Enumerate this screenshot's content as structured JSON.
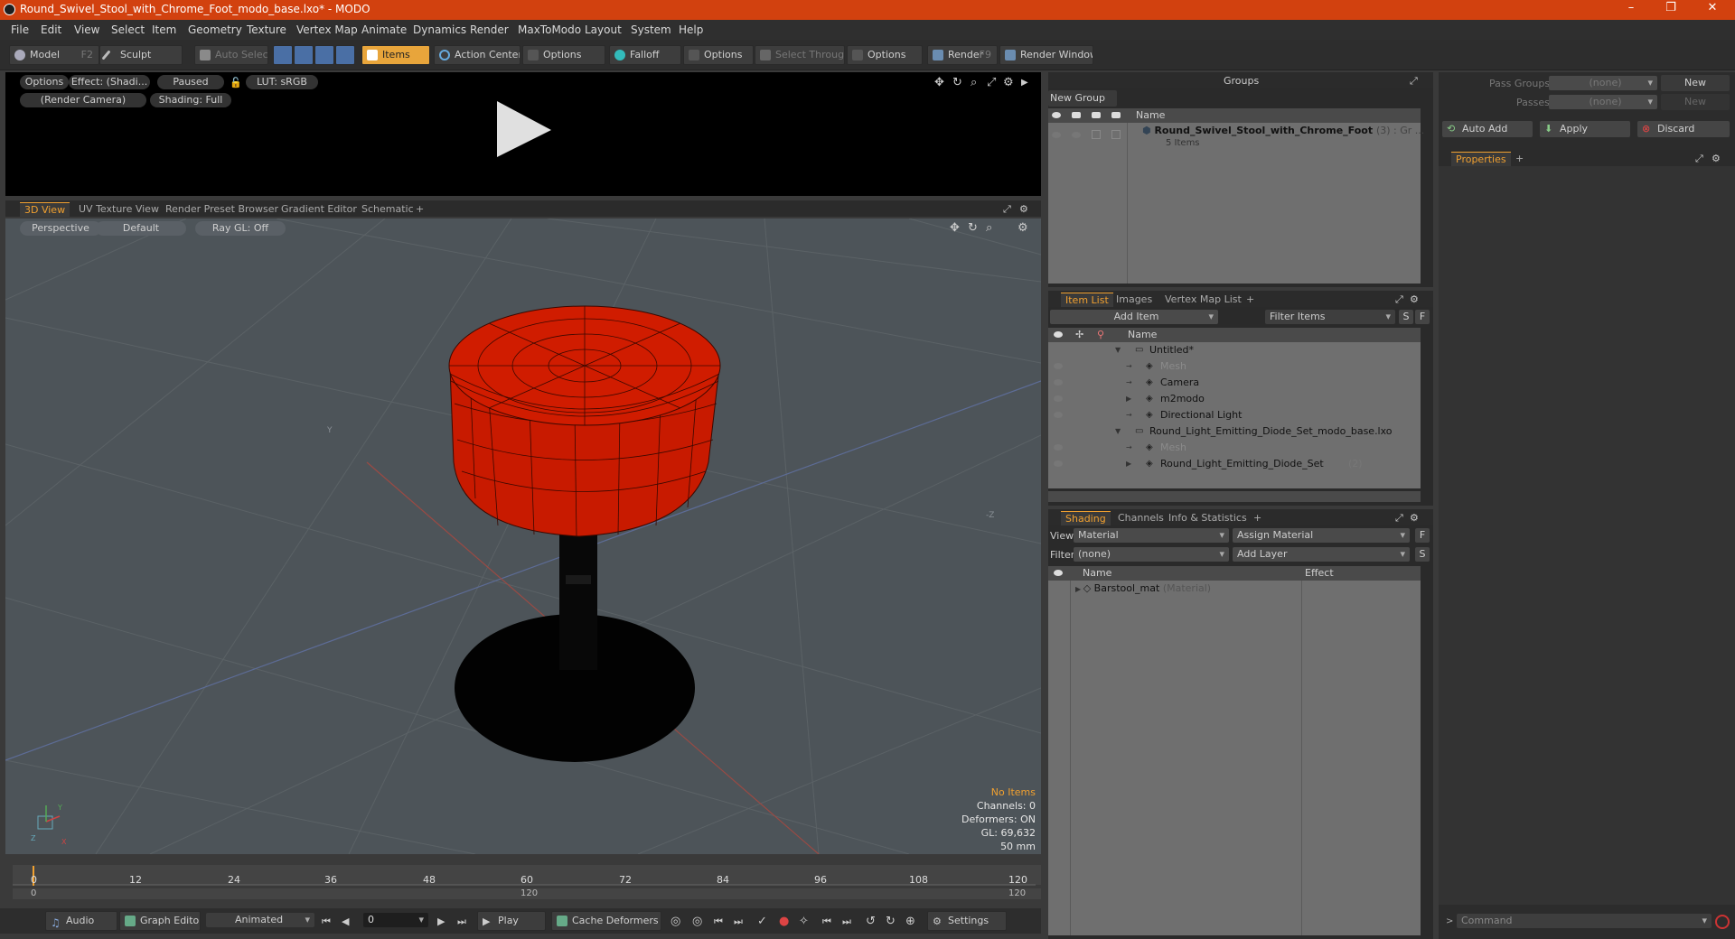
{
  "window": {
    "title": "Round_Swivel_Stool_with_Chrome_Foot_modo_base.lxo* - MODO",
    "minimize": "–",
    "maximize": "❐",
    "close": "✕"
  },
  "menu": [
    "File",
    "Edit",
    "View",
    "Select",
    "Item",
    "Geometry",
    "Texture",
    "Vertex Map",
    "Animate",
    "Dynamics",
    "Render",
    "MaxToModo",
    "Layout",
    "System",
    "Help"
  ],
  "toolbar": {
    "model": "Model",
    "model_key": "F2",
    "sculpt": "Sculpt",
    "auto_select": "Auto Select",
    "items": "Items",
    "action_center": "Action Center",
    "options1": "Options",
    "falloff": "Falloff",
    "options2": "Options",
    "select_through": "Select Through",
    "options3": "Options",
    "render": "Render",
    "render_key": "F9",
    "render_window": "Render Window"
  },
  "preview": {
    "options": "Options",
    "effect": "Effect: (Shadi...",
    "paused": "Paused",
    "lut": "LUT: sRGB",
    "camera": "(Render Camera)",
    "shading": "Shading: Full"
  },
  "view_tabs": [
    "3D View",
    "UV Texture View",
    "Render Preset Browser",
    "Gradient Editor",
    "Schematic",
    "+"
  ],
  "viewport": {
    "perspective": "Perspective",
    "default": "Default",
    "raygl": "Ray GL: Off",
    "no_items": "No Items",
    "channels": "Channels: 0",
    "deformers": "Deformers: ON",
    "gl": "GL: 69,632",
    "lens": "50 mm",
    "axis_y": "Y",
    "axis_z": "-Z",
    "axis_small_x": "X",
    "axis_small_y": "Y",
    "axis_small_z": "Z"
  },
  "timeline": {
    "ticks": [
      "0",
      "12",
      "24",
      "36",
      "48",
      "60",
      "72",
      "84",
      "96",
      "108",
      "120"
    ],
    "sub": [
      "0",
      "120",
      "120"
    ]
  },
  "bottom": {
    "audio": "Audio",
    "graph": "Graph Editor",
    "animated": "Animated",
    "frame": "0",
    "play": "Play",
    "cache": "Cache Deformers",
    "settings": "Settings"
  },
  "groups": {
    "title": "Groups",
    "new_group": "New Group",
    "col_name": "Name",
    "item_name": "Round_Swivel_Stool_with_Chrome_Foot",
    "item_suffix": "(3) : Gr ...",
    "item_count": "5 Items"
  },
  "item_tabs": [
    "Item List",
    "Images",
    "Vertex Map List",
    "+"
  ],
  "item_list": {
    "add_item": "Add Item",
    "filter": "Filter Items",
    "s": "S",
    "f": "F",
    "col_name": "Name",
    "rows": [
      {
        "label": "Untitled*",
        "dim": false,
        "indent": 0,
        "arrow": "▼"
      },
      {
        "label": "Mesh",
        "dim": true,
        "indent": 1,
        "arrow": ""
      },
      {
        "label": "Camera",
        "dim": false,
        "indent": 1,
        "arrow": ""
      },
      {
        "label": "m2modo",
        "dim": false,
        "indent": 1,
        "arrow": "▶"
      },
      {
        "label": "Directional Light",
        "dim": false,
        "indent": 1,
        "arrow": ""
      },
      {
        "label": "Round_Light_Emitting_Diode_Set_modo_base.lxo",
        "dim": false,
        "indent": 0,
        "arrow": "▼"
      },
      {
        "label": "Mesh",
        "dim": true,
        "indent": 1,
        "arrow": ""
      },
      {
        "label": "Round_Light_Emitting_Diode_Set",
        "dim": false,
        "indent": 1,
        "arrow": "▶",
        "suffix": "(2)"
      }
    ]
  },
  "shading_tabs": [
    "Shading",
    "Channels",
    "Info & Statistics",
    "+"
  ],
  "shading": {
    "view_label": "View",
    "view_value": "Material",
    "assign": "Assign Material",
    "f": "F",
    "filter_label": "Filter",
    "filter_value": "(none)",
    "add_layer": "Add Layer",
    "s": "S",
    "col_name": "Name",
    "col_effect": "Effect",
    "mat": "Barstool_mat",
    "mat_suffix": "(Material)"
  },
  "right": {
    "pass_groups": "Pass Groups",
    "passes": "Passes",
    "none1": "(none)",
    "none2": "(none)",
    "new1": "New",
    "new2": "New",
    "auto_add": "Auto Add",
    "apply": "Apply",
    "discard": "Discard",
    "properties": "Properties",
    "plus": "+",
    "command": "Command"
  },
  "colors": {
    "titlebar": "#d2410f",
    "accent": "#f0a030",
    "stool_red": "#cc1a00"
  }
}
